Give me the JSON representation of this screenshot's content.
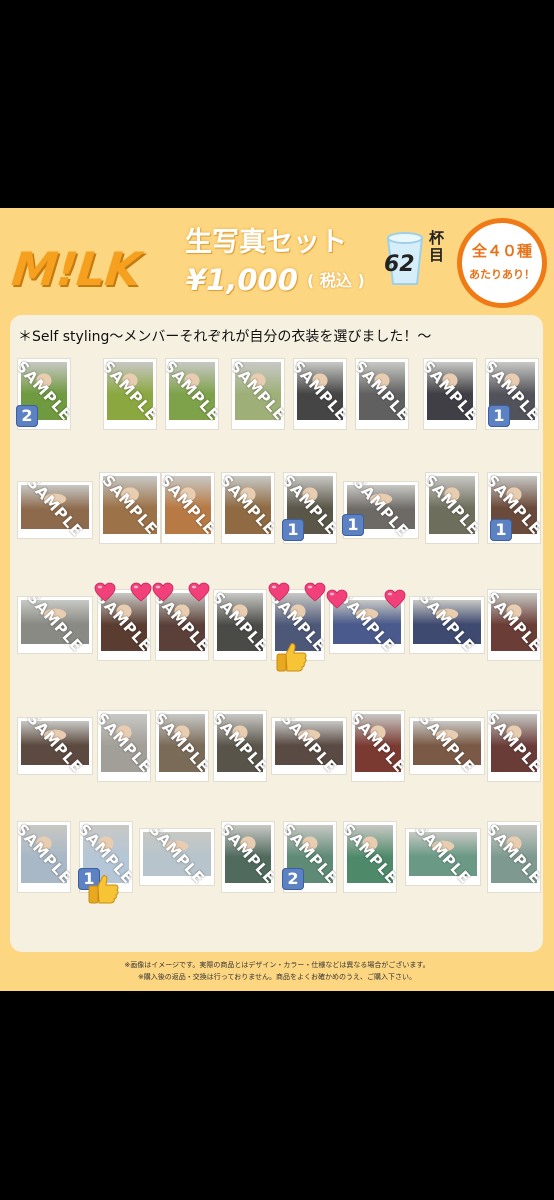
{
  "poster": {
    "logo": "M!LK",
    "title": "生写真セット",
    "price": "¥1,000",
    "tax": "( 税込 )",
    "cup_count": "62",
    "cup_unit": "杯目",
    "badge_line1": "全４０種",
    "badge_line2": "あたりあり！",
    "subtitle": "＊Self  styling～メンバーそれぞれが自分の衣装を選びました！～",
    "watermark": "SAMPLE",
    "footnote1": "※画像はイメージです。実際の商品とはデザイン・カラー・仕様などは異なる場合がございます。",
    "footnote2": "※購入後の返品・交換は行っておりません。商品をよくお確かめのうえ、ご購入下さい。"
  },
  "colors": {
    "poster_bg": "#fdd681",
    "panel_bg": "#f5f0e0",
    "logo_orange": "#f6a020",
    "badge_orange": "#ef7a16",
    "count_badge_blue": "#5d82c4",
    "heart_pink": "#f2417a",
    "thumb_yellow": "#f7c436"
  },
  "photos": [
    {
      "color": "#6f9a3f",
      "count": "2"
    },
    {
      "color": "#8ba840"
    },
    {
      "color": "#7ea24a"
    },
    {
      "color": "#9eb078"
    },
    {
      "color": "#454545"
    },
    {
      "color": "#606060"
    },
    {
      "color": "#3f3f45"
    },
    {
      "color": "#52525a",
      "count": "1"
    },
    {
      "color": "#8d6a4c"
    },
    {
      "color": "#9c7248"
    },
    {
      "color": "#b87a45"
    },
    {
      "color": "#8f6a42"
    },
    {
      "color": "#5a5648",
      "count": "1"
    },
    {
      "color": "#6d6a66",
      "count": "1"
    },
    {
      "color": "#6e6e5c"
    },
    {
      "color": "#6a4a3a",
      "count": "1"
    },
    {
      "color": "#8a8a84"
    },
    {
      "color": "#5a3c30",
      "hearts": 2
    },
    {
      "color": "#5a4038",
      "hearts": 2
    },
    {
      "color": "#4a4a46"
    },
    {
      "color": "#4d5878",
      "hearts": 2,
      "thumb": true
    },
    {
      "color": "#4a5a8c",
      "hearts": 2
    },
    {
      "color": "#3f4a70"
    },
    {
      "color": "#6a3d36"
    },
    {
      "color": "#5c4a40"
    },
    {
      "color": "#a29e98"
    },
    {
      "color": "#7a6a58"
    },
    {
      "color": "#58544a"
    },
    {
      "color": "#5a4a44"
    },
    {
      "color": "#7a3a32"
    },
    {
      "color": "#7a5a46"
    },
    {
      "color": "#6a3c38"
    },
    {
      "color": "#a9b8c6"
    },
    {
      "color": "#b5c6d6",
      "count": "1",
      "thumb": true
    },
    {
      "color": "#b7c4cc"
    },
    {
      "color": "#506a5e"
    },
    {
      "color": "#5e8a76",
      "count": "2"
    },
    {
      "color": "#4e8a6a"
    },
    {
      "color": "#6a9a86"
    },
    {
      "color": "#7e9a90"
    }
  ]
}
